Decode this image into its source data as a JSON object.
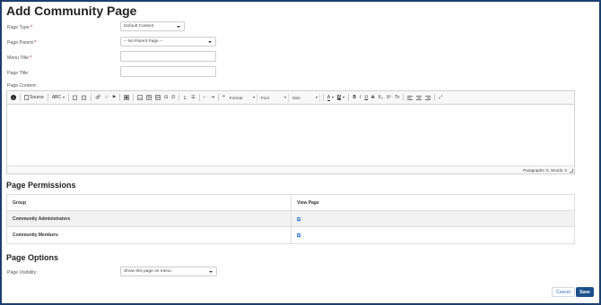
{
  "page": {
    "title": "Add Community Page"
  },
  "form": {
    "page_type_label": "Page Type:",
    "page_type_value": "Default Content",
    "page_parent_label": "Page Parent:",
    "page_parent_value": "-- No Parent Page --",
    "menu_title_label": "Menu Title:",
    "menu_title_value": "",
    "page_title_label": "Page Title:",
    "page_title_value": "",
    "page_content_label": "Page Content:",
    "required_mark": "*"
  },
  "editor": {
    "source_label": "Source",
    "format_label": "Format",
    "font_label": "Font",
    "size_label": "Size",
    "bold": "B",
    "italic": "I",
    "underline": "U",
    "strike": "S",
    "subscript": "X₂",
    "superscript": "X²",
    "remove_format": "Tx",
    "quote": "❝",
    "omega": "Ω",
    "text_color": "A",
    "bg_color": "A",
    "status": "Paragraphs: 0, Words: 0"
  },
  "permissions": {
    "heading": "Page Permissions",
    "col_group": "Group",
    "col_view": "View Page",
    "rows": [
      {
        "group": "Community Administrators",
        "view": true
      },
      {
        "group": "Community Members",
        "view": true
      }
    ]
  },
  "options": {
    "heading": "Page Options",
    "visibility_label": "Page Visibility:",
    "visibility_value": "Show this page on menu"
  },
  "actions": {
    "cancel": "Cancel",
    "save": "Save"
  }
}
